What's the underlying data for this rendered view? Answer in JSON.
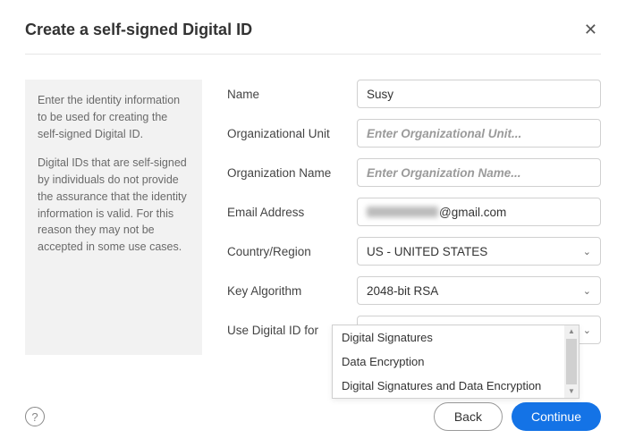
{
  "header": {
    "title": "Create a self-signed Digital ID"
  },
  "info": {
    "p1": "Enter the identity information to be used for creating the self-signed Digital ID.",
    "p2": "Digital IDs that are self-signed by individuals do not provide the assurance that the identity information is valid. For this reason they may not be accepted in some use cases."
  },
  "form": {
    "name_label": "Name",
    "name_value": "Susy",
    "org_unit_label": "Organizational Unit",
    "org_unit_placeholder": "Enter Organizational Unit...",
    "org_name_label": "Organization Name",
    "org_name_placeholder": "Enter Organization Name...",
    "email_label": "Email Address",
    "email_domain": "@gmail.com",
    "country_label": "Country/Region",
    "country_value": "US - UNITED STATES",
    "key_algo_label": "Key Algorithm",
    "key_algo_value": "2048-bit RSA",
    "use_for_label": "Use Digital ID for",
    "use_for_value": "Digital Signatures",
    "use_for_options": {
      "o1": "Digital Signatures",
      "o2": "Data Encryption",
      "o3": "Digital Signatures and Data Encryption"
    }
  },
  "footer": {
    "back": "Back",
    "continue": "Continue",
    "help": "?"
  }
}
